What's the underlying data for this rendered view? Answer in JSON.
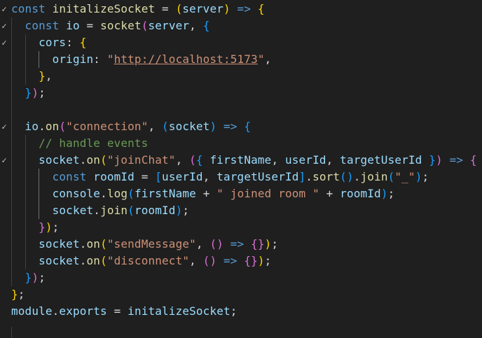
{
  "editor": {
    "language": "javascript",
    "fold_icon": "chevron-down-icon",
    "fold_glyph": "✓",
    "lines": [
      {
        "folded": true,
        "tokens": [
          {
            "t": "const",
            "c": "kw"
          },
          {
            "t": " ",
            "c": "plain"
          },
          {
            "t": "initalizeSocket",
            "c": "fn"
          },
          {
            "t": " = ",
            "c": "op"
          },
          {
            "t": "(",
            "c": "p1"
          },
          {
            "t": "server",
            "c": "param"
          },
          {
            "t": ")",
            "c": "p1"
          },
          {
            "t": " => ",
            "c": "kw"
          },
          {
            "t": "{",
            "c": "p1"
          }
        ]
      },
      {
        "folded": true,
        "tokens": [
          {
            "t": "  ",
            "c": "plain"
          },
          {
            "t": "const",
            "c": "kw"
          },
          {
            "t": " ",
            "c": "plain"
          },
          {
            "t": "io",
            "c": "var"
          },
          {
            "t": " = ",
            "c": "op"
          },
          {
            "t": "socket",
            "c": "fn"
          },
          {
            "t": "(",
            "c": "p2"
          },
          {
            "t": "server",
            "c": "var"
          },
          {
            "t": ", ",
            "c": "plain"
          },
          {
            "t": "{",
            "c": "p3"
          }
        ]
      },
      {
        "folded": true,
        "tokens": [
          {
            "t": "    ",
            "c": "plain"
          },
          {
            "t": "cors",
            "c": "prop"
          },
          {
            "t": ": ",
            "c": "plain"
          },
          {
            "t": "{",
            "c": "p1"
          }
        ]
      },
      {
        "folded": false,
        "tokens": [
          {
            "t": "      ",
            "c": "plain"
          },
          {
            "t": "origin",
            "c": "prop"
          },
          {
            "t": ": ",
            "c": "plain"
          },
          {
            "t": "\"",
            "c": "str"
          },
          {
            "t": "http://localhost:5173",
            "c": "str url"
          },
          {
            "t": "\"",
            "c": "str"
          },
          {
            "t": ",",
            "c": "plain"
          }
        ]
      },
      {
        "folded": false,
        "tokens": [
          {
            "t": "    ",
            "c": "plain"
          },
          {
            "t": "}",
            "c": "p1"
          },
          {
            "t": ",",
            "c": "plain"
          }
        ]
      },
      {
        "folded": false,
        "tokens": [
          {
            "t": "  ",
            "c": "plain"
          },
          {
            "t": "}",
            "c": "p3"
          },
          {
            "t": ")",
            "c": "p2"
          },
          {
            "t": ";",
            "c": "plain"
          }
        ]
      },
      {
        "folded": false,
        "tokens": []
      },
      {
        "folded": true,
        "tokens": [
          {
            "t": "  ",
            "c": "plain"
          },
          {
            "t": "io",
            "c": "var"
          },
          {
            "t": ".",
            "c": "plain"
          },
          {
            "t": "on",
            "c": "fn"
          },
          {
            "t": "(",
            "c": "p2"
          },
          {
            "t": "\"connection\"",
            "c": "str"
          },
          {
            "t": ", ",
            "c": "plain"
          },
          {
            "t": "(",
            "c": "p3"
          },
          {
            "t": "socket",
            "c": "param"
          },
          {
            "t": ")",
            "c": "p3"
          },
          {
            "t": " => ",
            "c": "kw"
          },
          {
            "t": "{",
            "c": "p3"
          }
        ]
      },
      {
        "folded": false,
        "tokens": [
          {
            "t": "    ",
            "c": "plain"
          },
          {
            "t": "// handle events",
            "c": "cm"
          }
        ]
      },
      {
        "folded": true,
        "tokens": [
          {
            "t": "    ",
            "c": "plain"
          },
          {
            "t": "socket",
            "c": "var"
          },
          {
            "t": ".",
            "c": "plain"
          },
          {
            "t": "on",
            "c": "fn"
          },
          {
            "t": "(",
            "c": "p1"
          },
          {
            "t": "\"joinChat\"",
            "c": "str"
          },
          {
            "t": ", ",
            "c": "plain"
          },
          {
            "t": "(",
            "c": "p2"
          },
          {
            "t": "{",
            "c": "p3"
          },
          {
            "t": " ",
            "c": "plain"
          },
          {
            "t": "firstName",
            "c": "param"
          },
          {
            "t": ", ",
            "c": "plain"
          },
          {
            "t": "userId",
            "c": "param"
          },
          {
            "t": ", ",
            "c": "plain"
          },
          {
            "t": "targetUserId",
            "c": "param"
          },
          {
            "t": " ",
            "c": "plain"
          },
          {
            "t": "}",
            "c": "p3"
          },
          {
            "t": ")",
            "c": "p2"
          },
          {
            "t": " => ",
            "c": "kw"
          },
          {
            "t": "{",
            "c": "p2"
          }
        ]
      },
      {
        "folded": false,
        "tokens": [
          {
            "t": "      ",
            "c": "plain"
          },
          {
            "t": "const",
            "c": "kw"
          },
          {
            "t": " ",
            "c": "plain"
          },
          {
            "t": "roomId",
            "c": "var"
          },
          {
            "t": " = ",
            "c": "op"
          },
          {
            "t": "[",
            "c": "p3"
          },
          {
            "t": "userId",
            "c": "var"
          },
          {
            "t": ", ",
            "c": "plain"
          },
          {
            "t": "targetUserId",
            "c": "var"
          },
          {
            "t": "]",
            "c": "p3"
          },
          {
            "t": ".",
            "c": "plain"
          },
          {
            "t": "sort",
            "c": "fn"
          },
          {
            "t": "(",
            "c": "p3"
          },
          {
            "t": ")",
            "c": "p3"
          },
          {
            "t": ".",
            "c": "plain"
          },
          {
            "t": "join",
            "c": "fn"
          },
          {
            "t": "(",
            "c": "p3"
          },
          {
            "t": "\"_\"",
            "c": "str"
          },
          {
            "t": ")",
            "c": "p3"
          },
          {
            "t": ";",
            "c": "plain"
          }
        ]
      },
      {
        "folded": false,
        "tokens": [
          {
            "t": "      ",
            "c": "plain"
          },
          {
            "t": "console",
            "c": "var"
          },
          {
            "t": ".",
            "c": "plain"
          },
          {
            "t": "log",
            "c": "fn"
          },
          {
            "t": "(",
            "c": "p3"
          },
          {
            "t": "firstName",
            "c": "var"
          },
          {
            "t": " + ",
            "c": "op"
          },
          {
            "t": "\" joined room \"",
            "c": "str"
          },
          {
            "t": " + ",
            "c": "op"
          },
          {
            "t": "roomId",
            "c": "var"
          },
          {
            "t": ")",
            "c": "p3"
          },
          {
            "t": ";",
            "c": "plain"
          }
        ]
      },
      {
        "folded": false,
        "tokens": [
          {
            "t": "      ",
            "c": "plain"
          },
          {
            "t": "socket",
            "c": "var"
          },
          {
            "t": ".",
            "c": "plain"
          },
          {
            "t": "join",
            "c": "fn"
          },
          {
            "t": "(",
            "c": "p3"
          },
          {
            "t": "roomId",
            "c": "var"
          },
          {
            "t": ")",
            "c": "p3"
          },
          {
            "t": ";",
            "c": "plain"
          }
        ]
      },
      {
        "folded": false,
        "tokens": [
          {
            "t": "    ",
            "c": "plain"
          },
          {
            "t": "}",
            "c": "p2"
          },
          {
            "t": ")",
            "c": "p1"
          },
          {
            "t": ";",
            "c": "plain"
          }
        ]
      },
      {
        "folded": false,
        "tokens": [
          {
            "t": "    ",
            "c": "plain"
          },
          {
            "t": "socket",
            "c": "var"
          },
          {
            "t": ".",
            "c": "plain"
          },
          {
            "t": "on",
            "c": "fn"
          },
          {
            "t": "(",
            "c": "p1"
          },
          {
            "t": "\"sendMessage\"",
            "c": "str"
          },
          {
            "t": ", ",
            "c": "plain"
          },
          {
            "t": "()",
            "c": "p2"
          },
          {
            "t": " => ",
            "c": "kw"
          },
          {
            "t": "{}",
            "c": "p2"
          },
          {
            "t": ")",
            "c": "p1"
          },
          {
            "t": ";",
            "c": "plain"
          }
        ]
      },
      {
        "folded": false,
        "tokens": [
          {
            "t": "    ",
            "c": "plain"
          },
          {
            "t": "socket",
            "c": "var"
          },
          {
            "t": ".",
            "c": "plain"
          },
          {
            "t": "on",
            "c": "fn"
          },
          {
            "t": "(",
            "c": "p1"
          },
          {
            "t": "\"disconnect\"",
            "c": "str"
          },
          {
            "t": ", ",
            "c": "plain"
          },
          {
            "t": "()",
            "c": "p2"
          },
          {
            "t": " => ",
            "c": "kw"
          },
          {
            "t": "{}",
            "c": "p2"
          },
          {
            "t": ")",
            "c": "p1"
          },
          {
            "t": ";",
            "c": "plain"
          }
        ]
      },
      {
        "folded": false,
        "tokens": [
          {
            "t": "  ",
            "c": "plain"
          },
          {
            "t": "}",
            "c": "p3"
          },
          {
            "t": ")",
            "c": "p2"
          },
          {
            "t": ";",
            "c": "plain"
          }
        ]
      },
      {
        "folded": false,
        "tokens": [
          {
            "t": "}",
            "c": "p1"
          },
          {
            "t": ";",
            "c": "plain"
          }
        ]
      },
      {
        "folded": false,
        "tokens": [
          {
            "t": "module",
            "c": "var"
          },
          {
            "t": ".",
            "c": "plain"
          },
          {
            "t": "exports",
            "c": "var"
          },
          {
            "t": " = ",
            "c": "op"
          },
          {
            "t": "initalizeSocket",
            "c": "var"
          },
          {
            "t": ";",
            "c": "plain"
          }
        ]
      }
    ]
  }
}
